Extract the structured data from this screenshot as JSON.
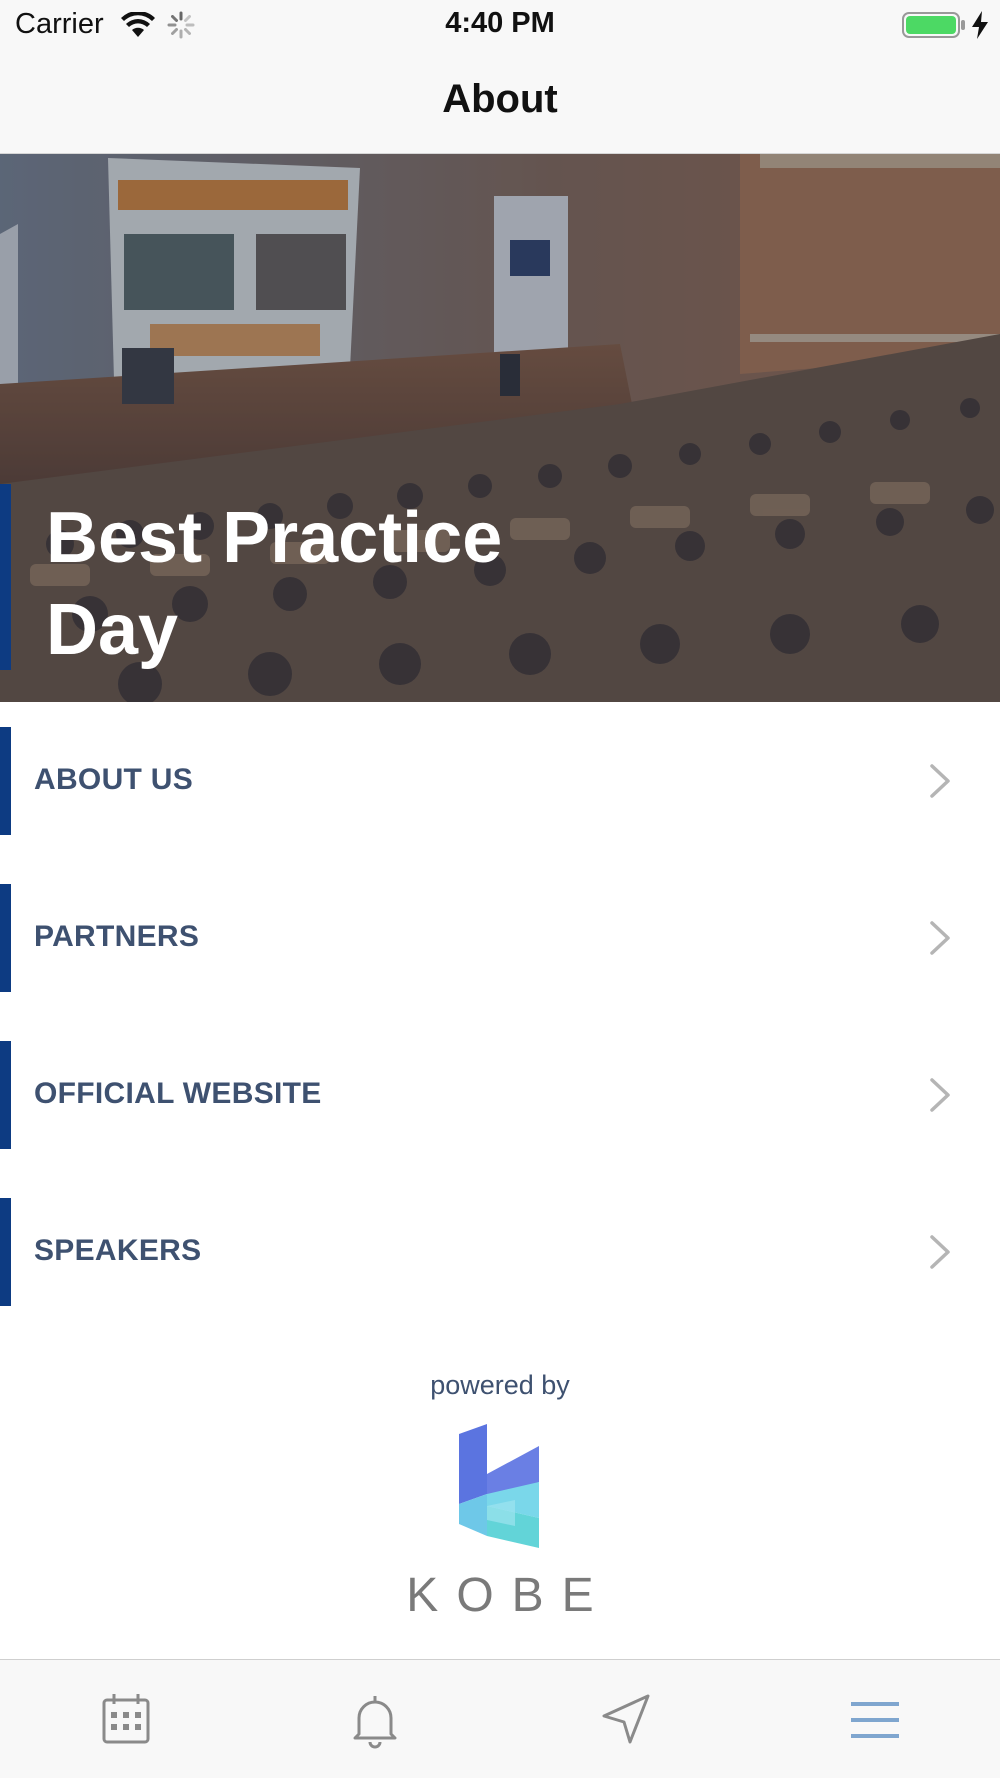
{
  "status_bar": {
    "carrier": "Carrier",
    "time": "4:40 PM"
  },
  "nav": {
    "title": "About"
  },
  "hero": {
    "title_line1": "Best Practice",
    "title_line2": "Day"
  },
  "menu": [
    {
      "label": "ABOUT US"
    },
    {
      "label": "PARTNERS"
    },
    {
      "label": "OFFICIAL WEBSITE"
    },
    {
      "label": "SPEAKERS"
    }
  ],
  "footer": {
    "powered_by": "powered by",
    "brand": "KOBE"
  },
  "tabs": [
    {
      "icon": "calendar-icon"
    },
    {
      "icon": "bell-icon"
    },
    {
      "icon": "navigation-arrow-icon"
    },
    {
      "icon": "hamburger-menu-icon"
    }
  ],
  "colors": {
    "accent": "#0d3b82",
    "menu_text": "#3e5170",
    "battery": "#4cd964"
  }
}
